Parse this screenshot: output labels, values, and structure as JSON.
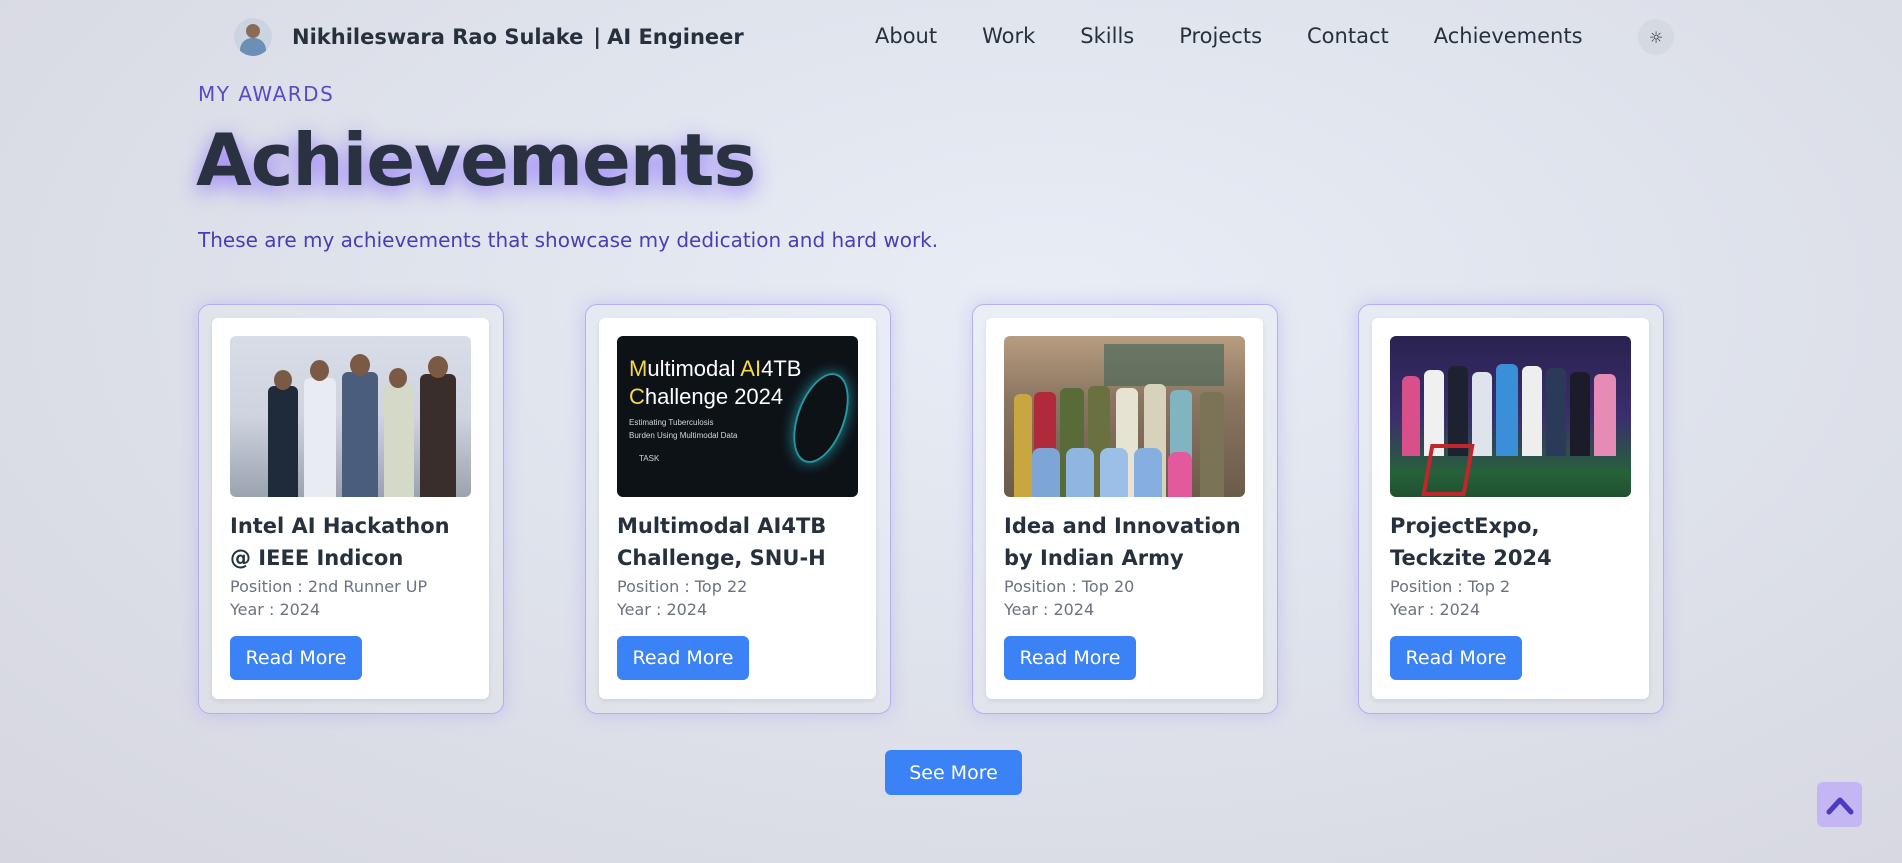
{
  "nav": {
    "brand_name": "Nikhileswara Rao Sulake",
    "brand_sep": "|",
    "brand_role": "AI Engineer",
    "links": [
      "About",
      "Work",
      "Skills",
      "Projects",
      "Contact",
      "Achievements"
    ],
    "theme_icon": "sun-icon"
  },
  "section": {
    "eyebrow": "MY AWARDS",
    "title": "Achievements",
    "subtitle": "These are my achievements that showcase my dedication and hard work."
  },
  "cards": [
    {
      "title": "Intel AI Hackathon @ IEEE Indicon",
      "position": "Position : 2nd Runner UP",
      "year": "Year : 2024",
      "button": "Read More"
    },
    {
      "title": "Multimodal AI4TB Challenge, SNU-H",
      "position": "Position : Top 22",
      "year": "Year : 2024",
      "button": "Read More"
    },
    {
      "title": "Idea and Innovation by Indian Army",
      "position": "Position : Top 20",
      "year": "Year : 2024",
      "button": "Read More"
    },
    {
      "title": "ProjectExpo, Teckzite 2024",
      "position": "Position : Top 2",
      "year": "Year : 2024",
      "button": "Read More"
    }
  ],
  "poster": {
    "line1_a": "M",
    "line1_b": "ultimodal ",
    "line1_c": "AI",
    "line1_d": "4TB",
    "line2_a": "C",
    "line2_b": "hallenge 2024",
    "sub1": "Estimating Tuberculosis",
    "sub2": "Burden Using Multimodal Data",
    "task": "TASK"
  },
  "see_more": "See More",
  "scroll_top_icon": "chevron-up-icon",
  "colors": {
    "accent": "#3b82f6",
    "eyebrow": "#5b4ac4",
    "card_border": "#b7adf3"
  }
}
